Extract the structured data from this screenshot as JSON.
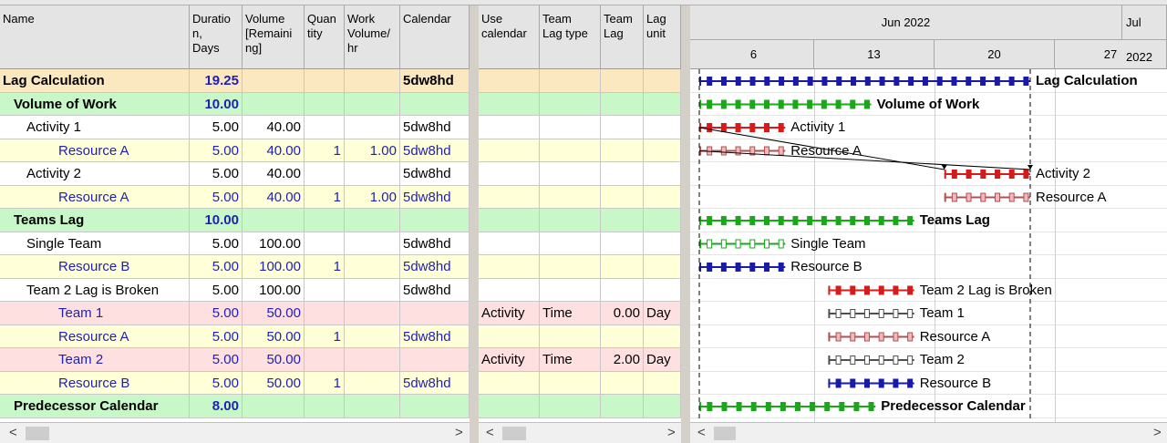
{
  "colors": {
    "row_summary": "#fbe8c0",
    "row_group": "#c8f7c8",
    "row_activity": "#ffffff",
    "row_resource": "#ffffd8",
    "row_team": "#ffe0e0",
    "bar_blue": "#1a1aa8",
    "bar_green": "#1aa81a",
    "bar_red": "#d81a1a",
    "bar_pink": "#f0b8b8",
    "bar_white": "#ffffff"
  },
  "left_table": {
    "columns": [
      {
        "key": "name",
        "label": "Name"
      },
      {
        "key": "duration",
        "label": "Duration, Days"
      },
      {
        "key": "volume",
        "label": "Volume [Remaining]"
      },
      {
        "key": "quantity",
        "label": "Quantity"
      },
      {
        "key": "workvol",
        "label": "Work Volume/ hr"
      },
      {
        "key": "calendar",
        "label": "Calendar"
      }
    ],
    "header_lines": {
      "name": [
        "Name"
      ],
      "duration": [
        "Duratio",
        "n,",
        "Days"
      ],
      "volume": [
        "Volume",
        "[Remaini",
        "ng]"
      ],
      "quantity": [
        "Quan",
        "tity"
      ],
      "workvol": [
        "Work",
        "Volume/",
        "hr"
      ],
      "calendar": [
        "Calendar"
      ]
    },
    "rows": [
      {
        "type": "summary",
        "indent": 0,
        "name": "Lag Calculation",
        "duration": "19.25",
        "volume": "",
        "quantity": "",
        "workvol": "",
        "calendar": "5dw8hd"
      },
      {
        "type": "group",
        "indent": 1,
        "name": "Volume of Work",
        "duration": "10.00",
        "volume": "",
        "quantity": "",
        "workvol": "",
        "calendar": ""
      },
      {
        "type": "activity",
        "indent": 2,
        "name": "Activity 1",
        "duration": "5.00",
        "volume": "40.00",
        "quantity": "",
        "workvol": "",
        "calendar": "5dw8hd"
      },
      {
        "type": "resource",
        "indent": 3,
        "name": "Resource A",
        "duration": "5.00",
        "volume": "40.00",
        "quantity": "1",
        "workvol": "1.00",
        "calendar": "5dw8hd"
      },
      {
        "type": "activity",
        "indent": 2,
        "name": "Activity 2",
        "duration": "5.00",
        "volume": "40.00",
        "quantity": "",
        "workvol": "",
        "calendar": "5dw8hd"
      },
      {
        "type": "resource",
        "indent": 3,
        "name": "Resource A",
        "duration": "5.00",
        "volume": "40.00",
        "quantity": "1",
        "workvol": "1.00",
        "calendar": "5dw8hd"
      },
      {
        "type": "group",
        "indent": 1,
        "name": "Teams Lag",
        "duration": "10.00",
        "volume": "",
        "quantity": "",
        "workvol": "",
        "calendar": ""
      },
      {
        "type": "activity",
        "indent": 2,
        "name": "Single Team",
        "duration": "5.00",
        "volume": "100.00",
        "quantity": "",
        "workvol": "",
        "calendar": "5dw8hd"
      },
      {
        "type": "resource",
        "indent": 3,
        "name": "Resource B",
        "duration": "5.00",
        "volume": "100.00",
        "quantity": "1",
        "workvol": "",
        "calendar": "5dw8hd"
      },
      {
        "type": "activity",
        "indent": 2,
        "name": "Team 2 Lag is Broken",
        "duration": "5.00",
        "volume": "100.00",
        "quantity": "",
        "workvol": "",
        "calendar": "5dw8hd"
      },
      {
        "type": "team",
        "indent": 3,
        "name": "Team 1",
        "duration": "5.00",
        "volume": "50.00",
        "quantity": "",
        "workvol": "",
        "calendar": ""
      },
      {
        "type": "resource",
        "indent": 3,
        "name": "Resource A",
        "duration": "5.00",
        "volume": "50.00",
        "quantity": "1",
        "workvol": "",
        "calendar": "5dw8hd"
      },
      {
        "type": "team",
        "indent": 3,
        "name": "Team 2",
        "duration": "5.00",
        "volume": "50.00",
        "quantity": "",
        "workvol": "",
        "calendar": ""
      },
      {
        "type": "resource",
        "indent": 3,
        "name": "Resource B",
        "duration": "5.00",
        "volume": "50.00",
        "quantity": "1",
        "workvol": "",
        "calendar": "5dw8hd"
      },
      {
        "type": "group",
        "indent": 1,
        "name": "Predecessor Calendar",
        "duration": "8.00",
        "volume": "",
        "quantity": "",
        "workvol": "",
        "calendar": ""
      }
    ]
  },
  "middle_table": {
    "header_lines": {
      "usecal": [
        "Use",
        "calendar"
      ],
      "lagtype": [
        "Team",
        "Lag type"
      ],
      "teamlag": [
        "Team",
        "Lag"
      ],
      "lagunit": [
        "Lag",
        "unit"
      ]
    },
    "rows": [
      {},
      {},
      {},
      {},
      {},
      {},
      {},
      {},
      {},
      {},
      {
        "usecal": "Activity",
        "lagtype": "Time",
        "teamlag": "0.00",
        "lagunit": "Day"
      },
      {},
      {
        "usecal": "Activity",
        "lagtype": "Time",
        "teamlag": "2.00",
        "lagunit": "Day"
      },
      {},
      {}
    ]
  },
  "gantt": {
    "months": [
      "Jun 2022",
      "Jul 2022"
    ],
    "weeks": [
      "6",
      "13",
      "20",
      "27"
    ],
    "bars": [
      {
        "label": "Lag Calculation",
        "bold": true,
        "color": "blue",
        "segments": [
          [
            0,
            19.25
          ]
        ],
        "style": "summary"
      },
      {
        "label": "Volume of Work",
        "bold": true,
        "color": "green",
        "segments": [
          [
            0,
            10.0
          ]
        ],
        "style": "summary"
      },
      {
        "label": "Activity 1",
        "bold": false,
        "color": "red",
        "segments": [
          [
            0,
            5
          ]
        ],
        "style": "task"
      },
      {
        "label": "Resource A",
        "bold": false,
        "color": "pink",
        "segments": [
          [
            0,
            5
          ]
        ],
        "style": "task"
      },
      {
        "label": "Activity 2",
        "bold": false,
        "color": "red",
        "segments": [
          [
            14.25,
            19.25
          ]
        ],
        "style": "task"
      },
      {
        "label": "Resource A",
        "bold": false,
        "color": "pink",
        "segments": [
          [
            14.25,
            19.25
          ]
        ],
        "style": "task"
      },
      {
        "label": "Teams Lag",
        "bold": true,
        "color": "green",
        "segments": [
          [
            0,
            12.5
          ]
        ],
        "style": "summary"
      },
      {
        "label": "Single Team",
        "bold": false,
        "color": "white-green",
        "segments": [
          [
            0,
            5
          ]
        ],
        "style": "task"
      },
      {
        "label": "Resource B",
        "bold": false,
        "color": "blue",
        "segments": [
          [
            0,
            5
          ]
        ],
        "style": "task"
      },
      {
        "label": "Team 2 Lag is Broken",
        "bold": false,
        "color": "red",
        "segments": [
          [
            7.5,
            12.5
          ]
        ],
        "style": "task"
      },
      {
        "label": "Team 1",
        "bold": false,
        "color": "white",
        "segments": [
          [
            7.5,
            12.5
          ]
        ],
        "style": "task"
      },
      {
        "label": "Resource A",
        "bold": false,
        "color": "pink",
        "segments": [
          [
            7.5,
            12.5
          ]
        ],
        "style": "task"
      },
      {
        "label": "Team 2",
        "bold": false,
        "color": "white",
        "segments": [
          [
            7.5,
            12.5
          ]
        ],
        "style": "task"
      },
      {
        "label": "Resource B",
        "bold": false,
        "color": "blue",
        "segments": [
          [
            7.5,
            12.5
          ]
        ],
        "style": "task"
      },
      {
        "label": "Predecessor Calendar",
        "bold": true,
        "color": "green",
        "segments": [
          [
            0,
            10.25
          ]
        ],
        "style": "summary"
      }
    ]
  },
  "scrollbars": {
    "left_arrow": "<",
    "right_arrow": ">"
  }
}
